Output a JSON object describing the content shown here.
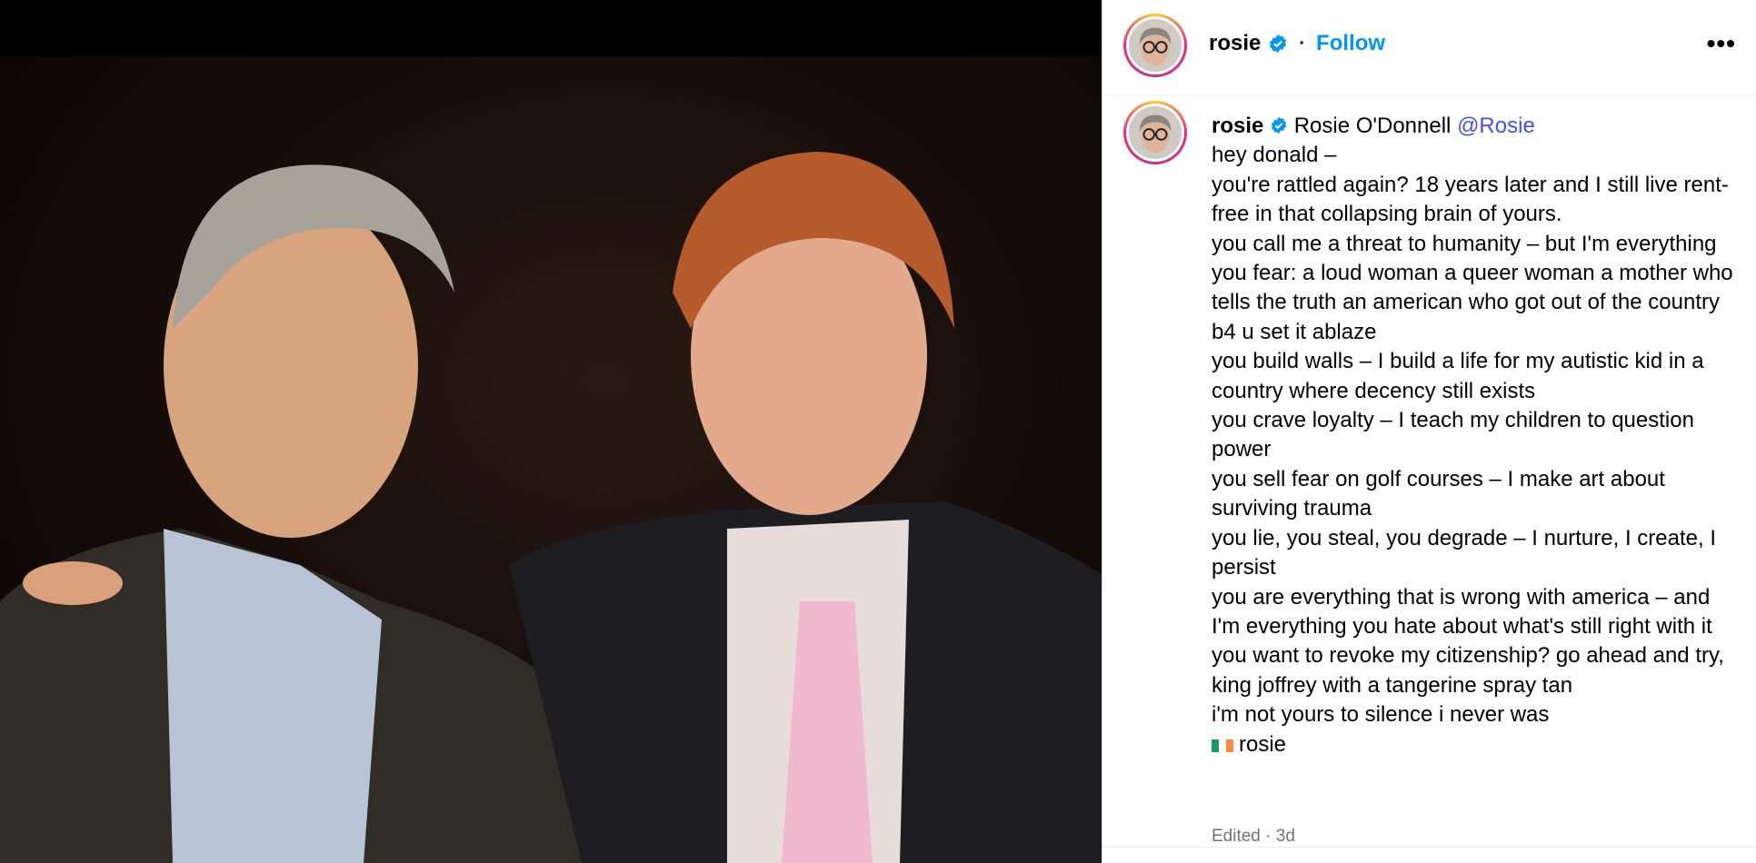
{
  "photo": {
    "alt_icon": "post-photo"
  },
  "header": {
    "username": "rosie",
    "separator": "·",
    "follow_label": "Follow",
    "more_label": "•••"
  },
  "caption": {
    "username": "rosie",
    "display_name": "Rosie O'Donnell",
    "mention": "@Rosie",
    "lines": [
      "hey donald –",
      "you're rattled again?  18 years later and I still live rent-free in that collapsing brain of yours.",
      "you call me a threat to humanity – but I'm everything you fear: a loud woman a queer woman a mother who tells the truth an american who got out of the country b4 u set it ablaze",
      "you build walls – I build a life for my autistic kid in a country where decency still exists",
      "you crave loyalty – I teach my children to question power",
      "you sell fear on golf courses – I make art about surviving trauma",
      "you lie, you steal, you degrade – I nurture, I create, I persist",
      "you are everything that is wrong with america – and I'm everything you hate about what's still right with it",
      "you want to revoke my citizenship? go ahead and try, king joffrey with a tangerine spray tan",
      "i'm not yours to silence i never was"
    ],
    "signoff": "rosie"
  },
  "meta": {
    "edited": "Edited · 3d"
  },
  "colors": {
    "follow": "#0095f6",
    "mention": "#4150f7",
    "verified": "#0095f6"
  }
}
